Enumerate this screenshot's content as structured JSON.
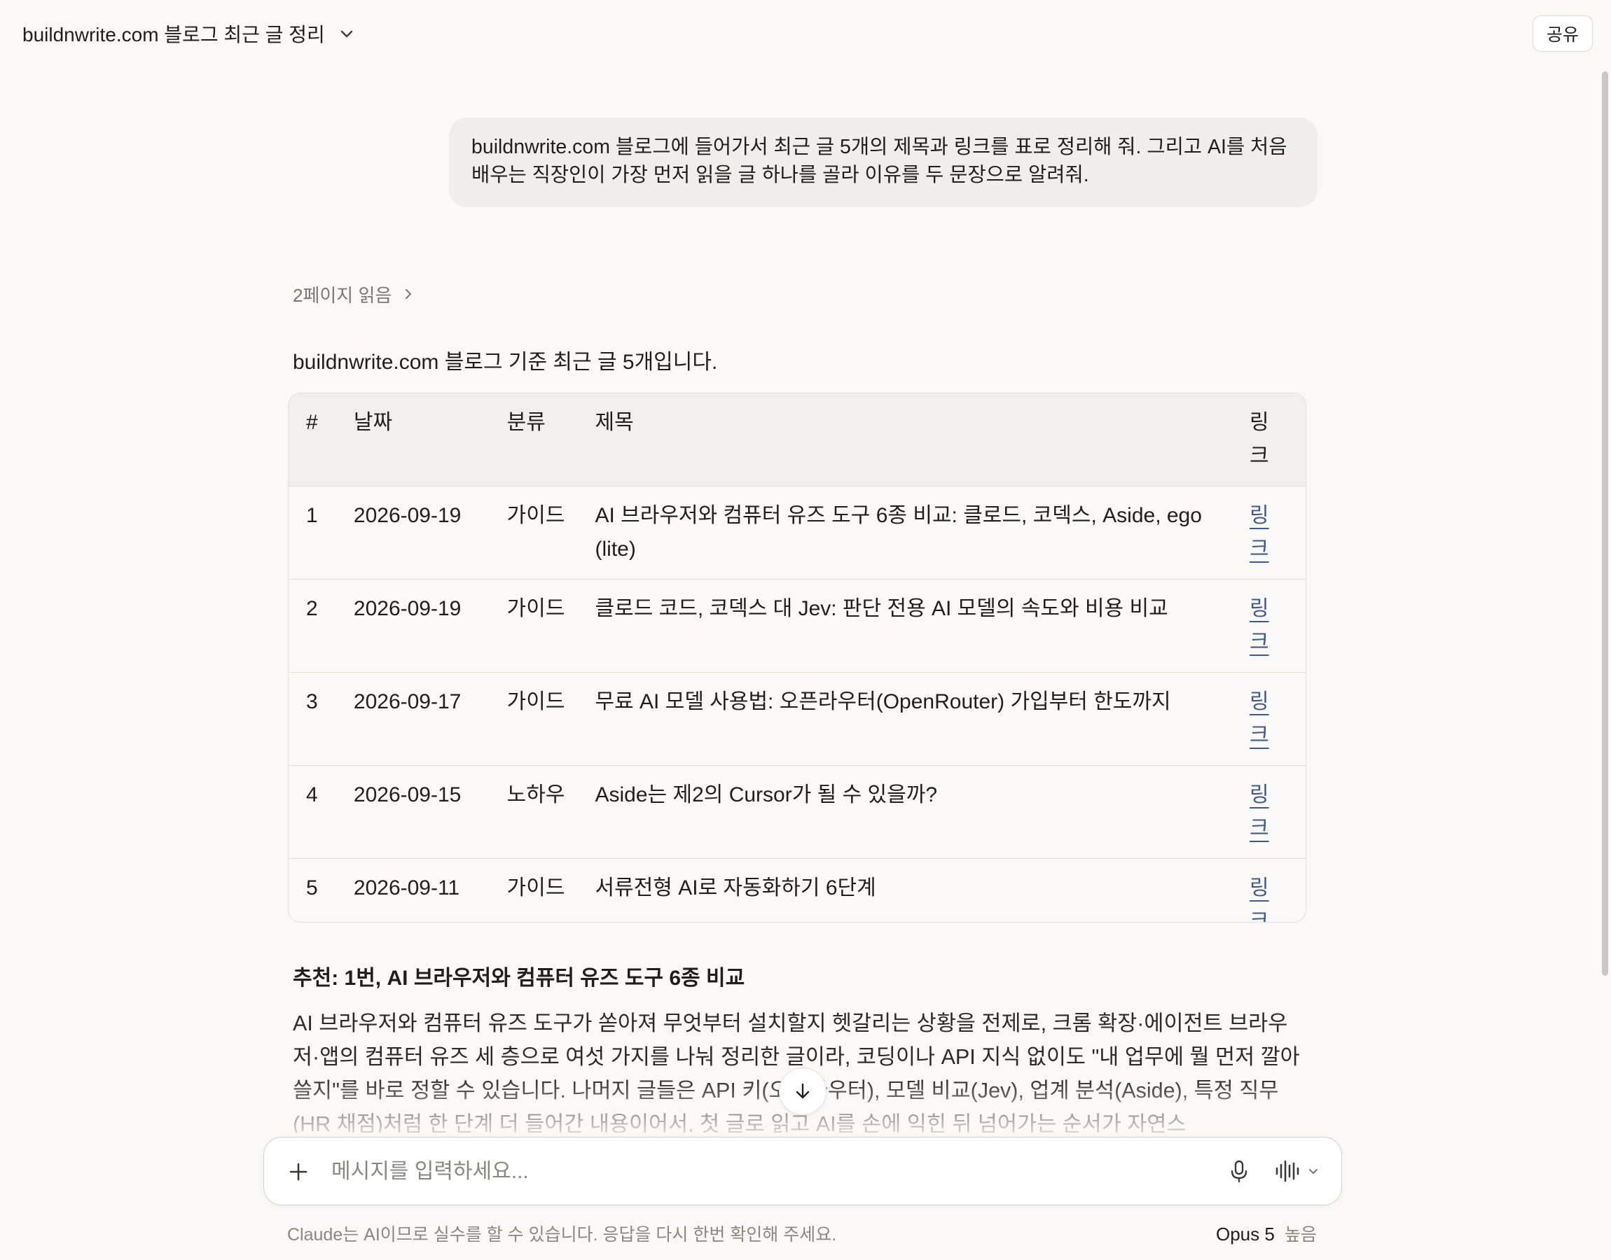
{
  "header": {
    "chat_title": "buildnwrite.com 블로그 최근 글 정리",
    "share_label": "공유"
  },
  "user_message": {
    "line1": "buildnwrite.com 블로그에 들어가서 최근 글 5개의 제목과 링크를 표로 정리해 줘. 그리고 AI를 처음",
    "line2": "배우는 직장인이 가장 먼저 읽을 글 하나를 골라 이유를 두 문장으로 알려줘."
  },
  "assistant": {
    "pages_read": "2페이지 읽음",
    "intro": "buildnwrite.com 블로그 기준 최근 글 5개입니다.",
    "table": {
      "headers": [
        "#",
        "날짜",
        "분류",
        "제목",
        "링크"
      ],
      "rows": [
        {
          "num": "1",
          "date": "2026-09-19",
          "category": "가이드",
          "title": "AI 브라우저와 컴퓨터 유즈 도구 6종 비교: 클로드, 코덱스, Aside, ego (lite)",
          "link": "링크"
        },
        {
          "num": "2",
          "date": "2026-09-19",
          "category": "가이드",
          "title": "클로드 코드, 코덱스 대 Jev: 판단 전용 AI 모델의 속도와 비용 비교",
          "link": "링크"
        },
        {
          "num": "3",
          "date": "2026-09-17",
          "category": "가이드",
          "title": "무료 AI 모델 사용법: 오픈라우터(OpenRouter) 가입부터 한도까지",
          "link": "링크"
        },
        {
          "num": "4",
          "date": "2026-09-15",
          "category": "노하우",
          "title": "Aside는 제2의 Cursor가 될 수 있을까?",
          "link": "링크"
        },
        {
          "num": "5",
          "date": "2026-09-11",
          "category": "가이드",
          "title": "서류전형 AI로 자동화하기 6단계",
          "link": "링크"
        }
      ]
    },
    "recommendation_heading": "추천: 1번, AI 브라우저와 컴퓨터 유즈 도구 6종 비교",
    "recommendation_body": "AI 브라우저와 컴퓨터 유즈 도구가 쏟아져 무엇부터 설치할지 헷갈리는 상황을 전제로, 크롬 확장·에이전트 브라우저·앱의 컴퓨터 유즈 세 층으로 여섯 가지를 나눠 정리한 글이라, 코딩이나 API 지식 없이도 \"내 업무에 뭘 먼저 깔아 쓸지\"를 바로 정할 수 있습니다. 나머지 글들은 API 키(오픈라우터), 모델 비교(Jev), 업계 분석(Aside), 특정 직무(HR 채점)처럼 한 단계 더 들어간 내용이어서, 첫 글로 읽고 AI를 손에 익힌 뒤 넘어가는 순서가 자연스"
  },
  "composer": {
    "placeholder": "메시지를 입력하세요..."
  },
  "footer": {
    "disclaimer": "Claude는 AI이므로 실수를 할 수 있습니다. 응답을 다시 한번 확인해 주세요.",
    "model": "Opus 5",
    "effort": "높음"
  },
  "icons": {
    "title_dropdown": "chevron-down-icon",
    "pages_read": "chevron-right-icon",
    "scroll_down": "arrow-down-icon",
    "add": "plus-icon",
    "mic": "microphone-icon",
    "voice": "voice-waveform-icon"
  },
  "colors": {
    "background": "#faf9f7",
    "user_bubble": "#efeeeb",
    "table_header": "#f0efec",
    "link": "#3d5a96"
  }
}
